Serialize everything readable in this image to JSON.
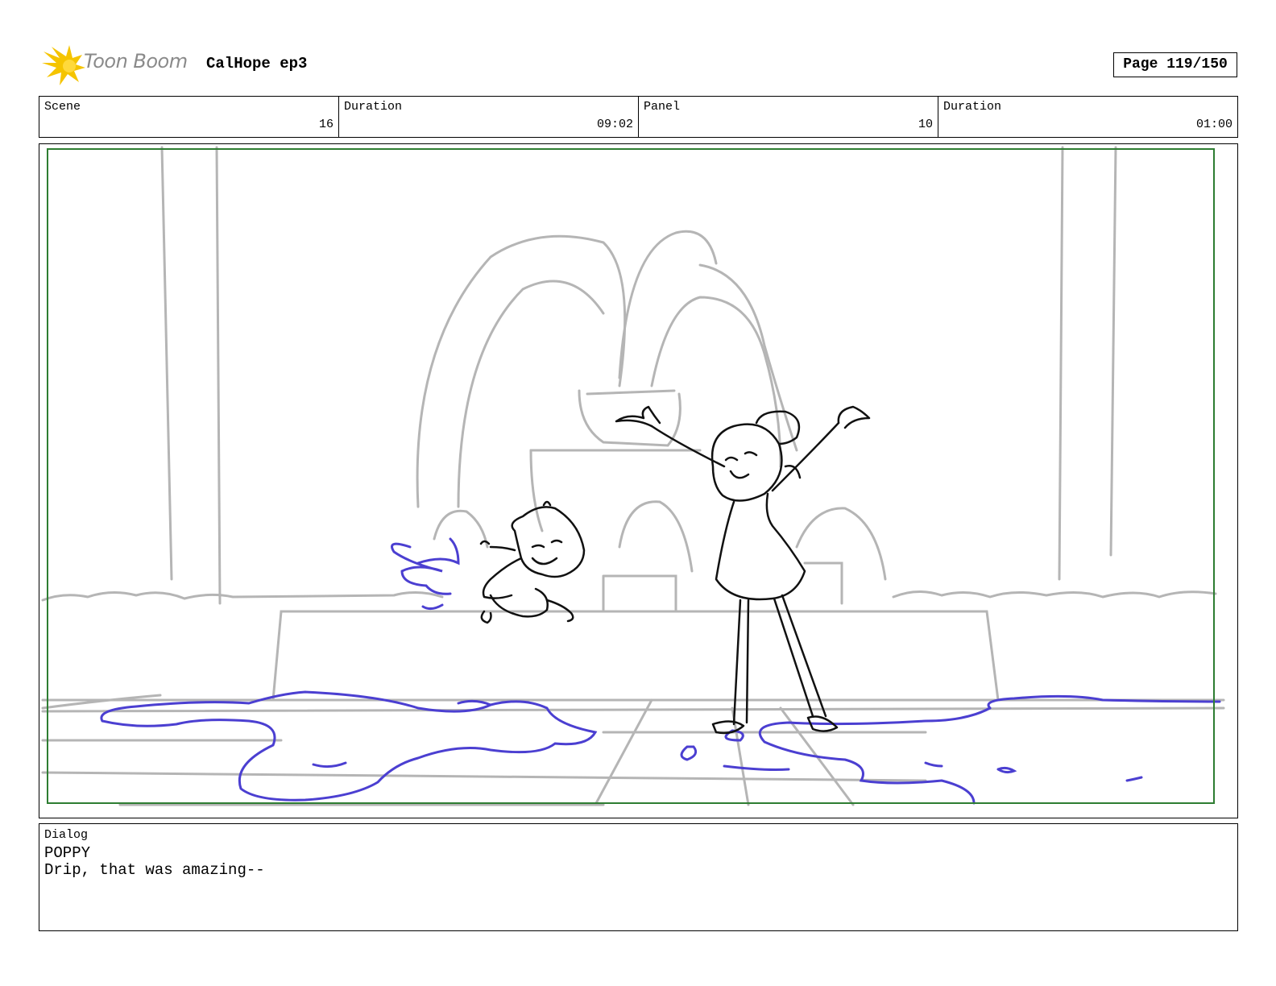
{
  "header": {
    "logo_text": "Toon Boom",
    "project_title": "CalHope ep3",
    "page_label": "Page 119/150"
  },
  "info": {
    "scene_label": "Scene",
    "scene_value": "16",
    "scene_duration_label": "Duration",
    "scene_duration_value": "09:02",
    "panel_label": "Panel",
    "panel_value": "10",
    "panel_duration_label": "Duration",
    "panel_duration_value": "01:00"
  },
  "dialog": {
    "label": "Dialog",
    "speaker": "POPPY",
    "line": "Drip, that was amazing--"
  },
  "colors": {
    "safe_frame": "#2e7d32",
    "sketch_gray": "#b5b5b5",
    "water_blue": "#4b3fd1",
    "ink": "#111111",
    "logo_yellow": "#f5c400"
  }
}
